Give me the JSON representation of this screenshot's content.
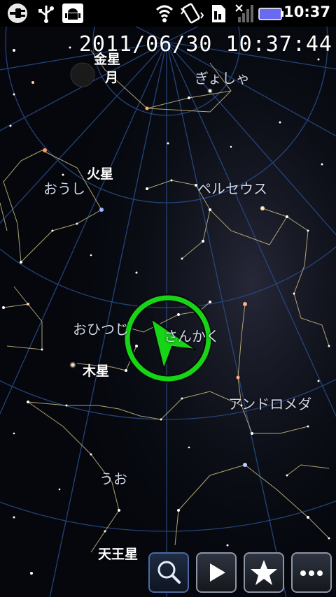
{
  "status_bar": {
    "time": "10:37",
    "icons": [
      "usb-connection-icon",
      "usb-icon",
      "android-debug-icon",
      "wifi-icon",
      "vibrate-icon",
      "sd-card-icon",
      "signal-icon",
      "battery-icon"
    ]
  },
  "sky": {
    "datetime": "2011/06/30  10:37:44",
    "labels": {
      "kinsei": "金星",
      "tsuki": "月",
      "gyosha": "ぎょしゃ",
      "kasei": "火星",
      "oushi": "おうし",
      "perseus": "ペルセウス",
      "ohitsuji": "おひつじ",
      "sankaku": "さんかく",
      "mokusei": "木星",
      "andromeda": "アンドロメダ",
      "uo": "うお",
      "tennousei": "天王星"
    }
  },
  "toolbar": {
    "buttons": [
      {
        "name": "search",
        "icon": "magnifier-icon"
      },
      {
        "name": "play",
        "icon": "play-icon"
      },
      {
        "name": "favorite",
        "icon": "star-icon"
      },
      {
        "name": "more",
        "icon": "more-dots-icon"
      }
    ]
  },
  "colors": {
    "grid_line": "#2a4d8a",
    "constellation_line": "#d8c98a",
    "pointer": "#16d416"
  }
}
